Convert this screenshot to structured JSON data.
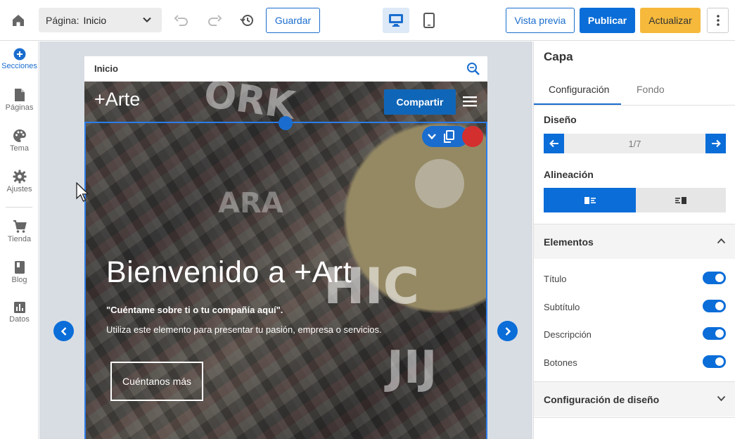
{
  "topbar": {
    "page_label": "Página:",
    "page_value": "Inicio",
    "save_label": "Guardar",
    "preview_label": "Vista previa",
    "publish_label": "Publicar",
    "update_label": "Actualizar"
  },
  "sidebar": {
    "items": [
      {
        "label": "Secciones",
        "icon": "add-circle-icon",
        "active": true
      },
      {
        "label": "Páginas",
        "icon": "page-icon"
      },
      {
        "label": "Tema",
        "icon": "palette-icon"
      },
      {
        "label": "Ajustes",
        "icon": "gear-icon"
      },
      {
        "label": "Tienda",
        "icon": "cart-icon"
      },
      {
        "label": "Blog",
        "icon": "book-icon"
      },
      {
        "label": "Datos",
        "icon": "chart-icon"
      }
    ]
  },
  "preview": {
    "url_title": "Inicio",
    "brand": "+Arte",
    "share_label": "Compartir",
    "hero_title": "Bienvenido a +Art",
    "hero_subtitle": "\"Cuéntame sobre ti o tu compañía aquí\".",
    "hero_description": "Utiliza este elemento para presentar tu pasión, empresa o servicios.",
    "hero_button": "Cuéntanos más"
  },
  "panel": {
    "title": "Capa",
    "tabs": [
      "Configuración",
      "Fondo"
    ],
    "design_label": "Diseño",
    "design_counter": "1/7",
    "alignment_label": "Alineación",
    "elements_label": "Elementos",
    "toggles": [
      {
        "label": "Título",
        "on": true
      },
      {
        "label": "Subtítulo",
        "on": true
      },
      {
        "label": "Descripción",
        "on": true
      },
      {
        "label": "Botones",
        "on": true
      }
    ],
    "design_settings_label": "Configuración de diseño"
  },
  "colors": {
    "accent": "#0a6dd8",
    "update": "#f6b93b",
    "handle_red": "#d32f2f"
  }
}
